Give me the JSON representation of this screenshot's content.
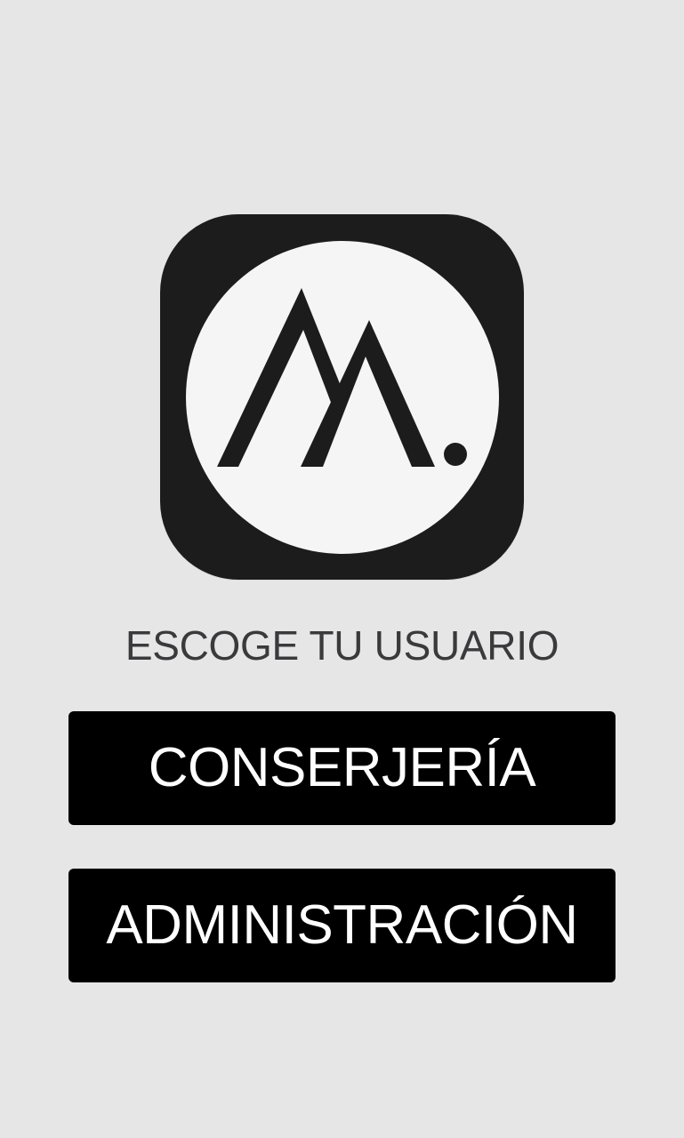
{
  "logo": {
    "icon": "mountain-m-logo-icon",
    "tile_color": "#1c1c1c",
    "circle_color": "#f5f5f5",
    "mark_color": "#1c1c1c"
  },
  "prompt": {
    "text": "ESCOGE TU USUARIO"
  },
  "roles": [
    {
      "label": "CONSERJERÍA"
    },
    {
      "label": "ADMINISTRACIÓN"
    }
  ],
  "colors": {
    "background": "#e6e6e6",
    "button_bg": "#000000",
    "button_text": "#ffffff",
    "prompt_text": "#3a3a3c"
  }
}
